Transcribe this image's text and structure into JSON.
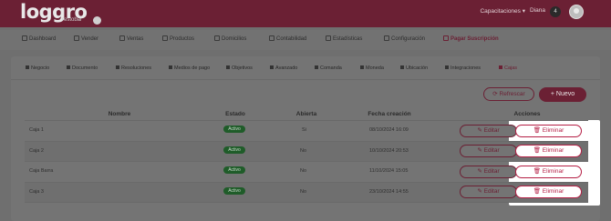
{
  "brand": {
    "logo_text": "loggro",
    "logo_sub": "restobar"
  },
  "topbar": {
    "capacitaciones": "Capacitaciones",
    "user": "Diana",
    "notifications": "4"
  },
  "main_nav": [
    {
      "label": "Dashboard",
      "icon": "dashboard-icon"
    },
    {
      "label": "Vender",
      "icon": "cart-icon"
    },
    {
      "label": "Ventas",
      "icon": "tag-icon"
    },
    {
      "label": "Productos",
      "icon": "bag-icon"
    },
    {
      "label": "Domicilios",
      "icon": "bike-icon"
    },
    {
      "label": "Contabilidad",
      "icon": "ledger-icon"
    },
    {
      "label": "Estadísticas",
      "icon": "chart-icon"
    },
    {
      "label": "Configuración",
      "icon": "gear-icon"
    },
    {
      "label": "Pagar Suscripción",
      "icon": "card-icon",
      "active": true
    }
  ],
  "sub_nav": [
    {
      "label": "Negocio"
    },
    {
      "label": "Documento"
    },
    {
      "label": "Resoluciones"
    },
    {
      "label": "Medios de pago"
    },
    {
      "label": "Objetivos"
    },
    {
      "label": "Avanzado"
    },
    {
      "label": "Comanda"
    },
    {
      "label": "Moneda"
    },
    {
      "label": "Ubicación"
    },
    {
      "label": "Integraciones"
    },
    {
      "label": "Cajas",
      "active": true
    }
  ],
  "actions": {
    "refresh": "Refrescar",
    "new": "Nuevo"
  },
  "table": {
    "headers": {
      "nombre": "Nombre",
      "estado": "Estado",
      "abierta": "Abierta",
      "fecha": "Fecha creación",
      "acciones": "Acciones"
    },
    "rows": [
      {
        "nombre": "Caja 1",
        "estado": "Activo",
        "abierta": "Si",
        "fecha": "08/10/2024 16:09"
      },
      {
        "nombre": "Caja 2",
        "estado": "Activo",
        "abierta": "No",
        "fecha": "10/10/2024 20:53"
      },
      {
        "nombre": "Caja Barra",
        "estado": "Activo",
        "abierta": "No",
        "fecha": "11/10/2024 15:05"
      },
      {
        "nombre": "Caja 3",
        "estado": "Activo",
        "abierta": "No",
        "fecha": "23/10/2024 14:55"
      }
    ],
    "edit_label": "Editar",
    "delete_label": "Eliminar"
  },
  "colors": {
    "brand": "#6b2034",
    "danger": "#b41e44",
    "active_badge": "#1f5c29"
  }
}
